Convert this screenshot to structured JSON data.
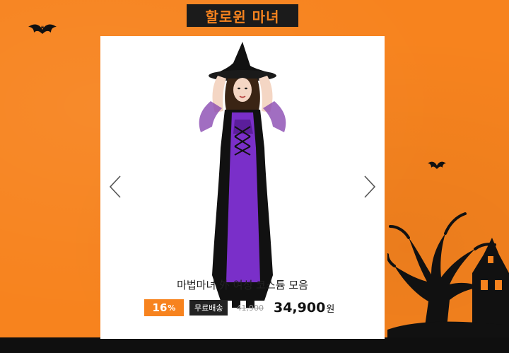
{
  "banner": {
    "title": "할로윈 마녀"
  },
  "product": {
    "name": "마법마녀 外 여성 코스튬 모음",
    "discount_value": "16",
    "discount_unit": "%",
    "shipping_badge": "무료배송",
    "original_price": "41,900",
    "sale_price": "34,900",
    "sale_unit": "원"
  },
  "icons": {
    "prev": "chevron-left-icon",
    "next": "chevron-right-icon",
    "bat": "bat-icon",
    "tree": "spooky-tree",
    "house": "haunted-house"
  },
  "colors": {
    "background": "#f7831e",
    "accent": "#f7831e",
    "dark": "#1b1b1b",
    "dress_purple": "#7a2fc9"
  }
}
